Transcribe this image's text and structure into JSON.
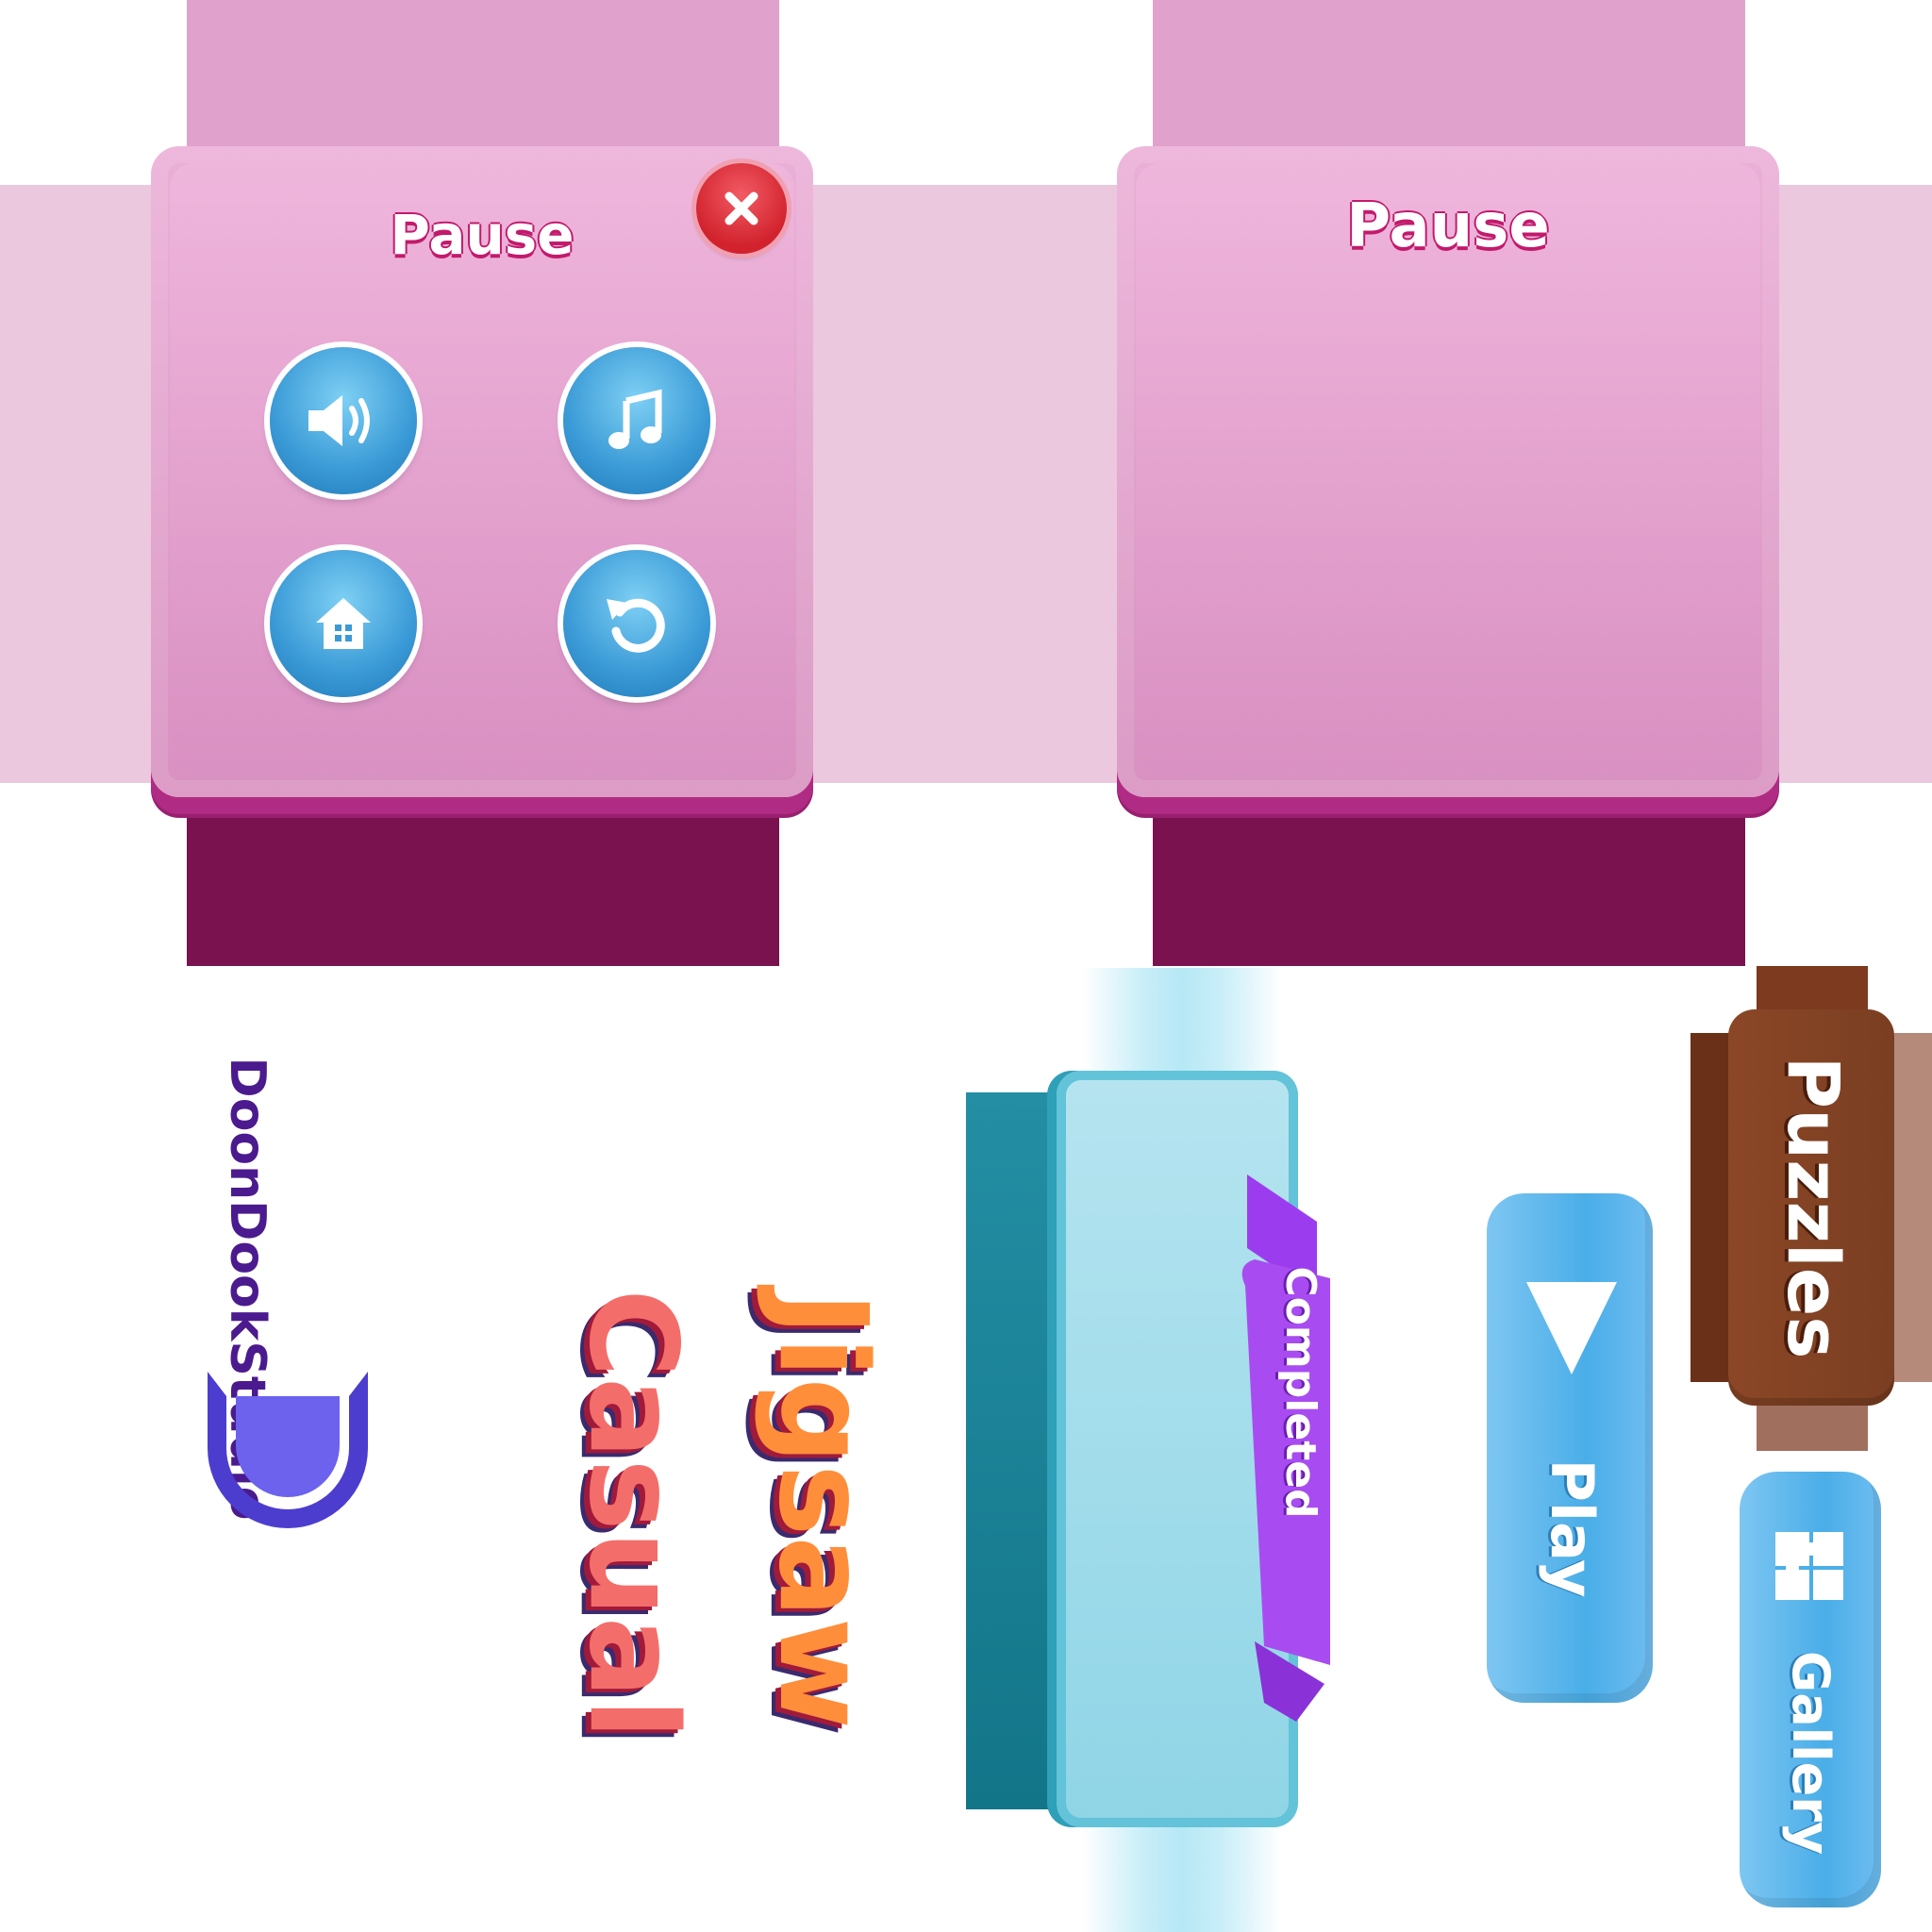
{
  "pause_panel_with_buttons": {
    "title": "Pause",
    "buttons": [
      "sound",
      "music",
      "home",
      "restart"
    ],
    "close_icon": "close-icon"
  },
  "pause_panel_empty": {
    "title": "Pause"
  },
  "studio": {
    "name": "DoonDookStudio",
    "logo_color": "#6257e8",
    "text_color": "#4b1a8e"
  },
  "game_title": {
    "line1": "Jigsaw",
    "line2": "Casual"
  },
  "completed_card": {
    "ribbon_text": "Completed"
  },
  "buttons": {
    "play_label": "Play",
    "gallery_label": "Gallery",
    "puzzles_label": "Puzzles"
  },
  "colors": {
    "panel_pink": "#e6a8d2",
    "panel_shadow": "#b02b83",
    "dark_magenta": "#7a1250",
    "button_blue": "#4aaee8",
    "teal_card": "#9ddced",
    "teal_dark": "#1f8aa0",
    "ribbon_purple": "#a44bf0",
    "brown": "#7a3e22"
  }
}
